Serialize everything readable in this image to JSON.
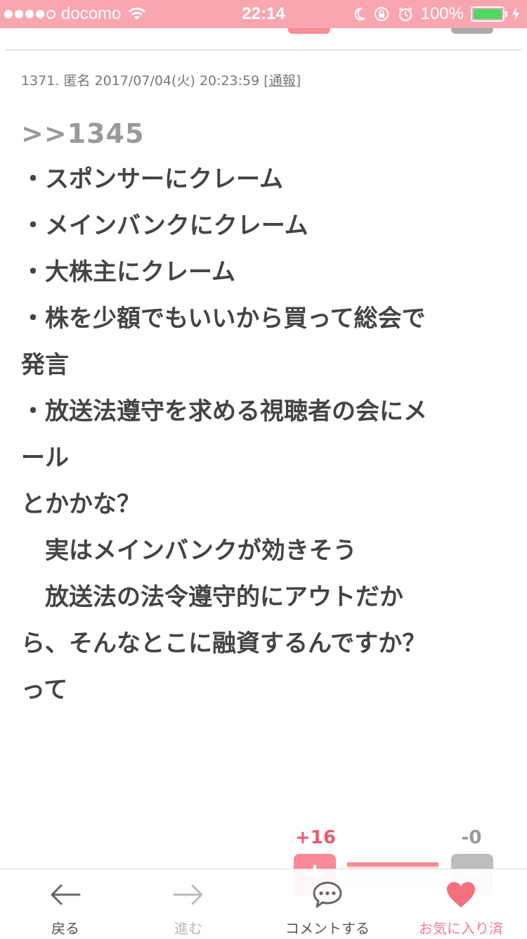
{
  "status_bar": {
    "carrier": "docomo",
    "time": "22:14",
    "battery_percent": "100%",
    "signal_bars": 4,
    "battery_level": 1.0,
    "colors": {
      "background": "#f8a6b0",
      "battery_fill": "#4cd964"
    },
    "icons": [
      "wifi-icon",
      "moon-icon",
      "rotation-lock-icon",
      "alarm-icon",
      "charging-icon"
    ]
  },
  "post": {
    "meta": {
      "number": "1371.",
      "author": "匿名",
      "datetime": "2017/07/04(火) 20:23:59",
      "report_open": "[",
      "report_label": "通報",
      "report_close": "]"
    },
    "anchor": ">>1345",
    "lines": [
      "・スポンサーにクレーム",
      "・メインバンクにクレーム",
      "・大株主にクレーム",
      "・株を少額でもいいから買って総会で",
      "発言",
      "・放送法遵守を求める視聴者の会にメ",
      "ール",
      "とかかな？",
      "　実はメインバンクが効きそう",
      "　放送法の法令遵守的にアウトだか",
      "ら、そんなとこに融資するんですか？",
      "って"
    ]
  },
  "vote": {
    "plus_count": "+16",
    "minus_count": "-0",
    "plus_symbol": "+",
    "minus_symbol": "−",
    "plus_ratio": 1.0,
    "colors": {
      "plus": "#f98a97",
      "minus": "#bdbdbd"
    }
  },
  "bottom_nav": {
    "back": "戻る",
    "forward": "進む",
    "comment": "コメントする",
    "favorite": "お気に入り済",
    "icons": [
      "arrow-left-icon",
      "arrow-right-icon",
      "chat-bubble-icon",
      "heart-icon"
    ],
    "accent_color": "#f57a8a"
  }
}
